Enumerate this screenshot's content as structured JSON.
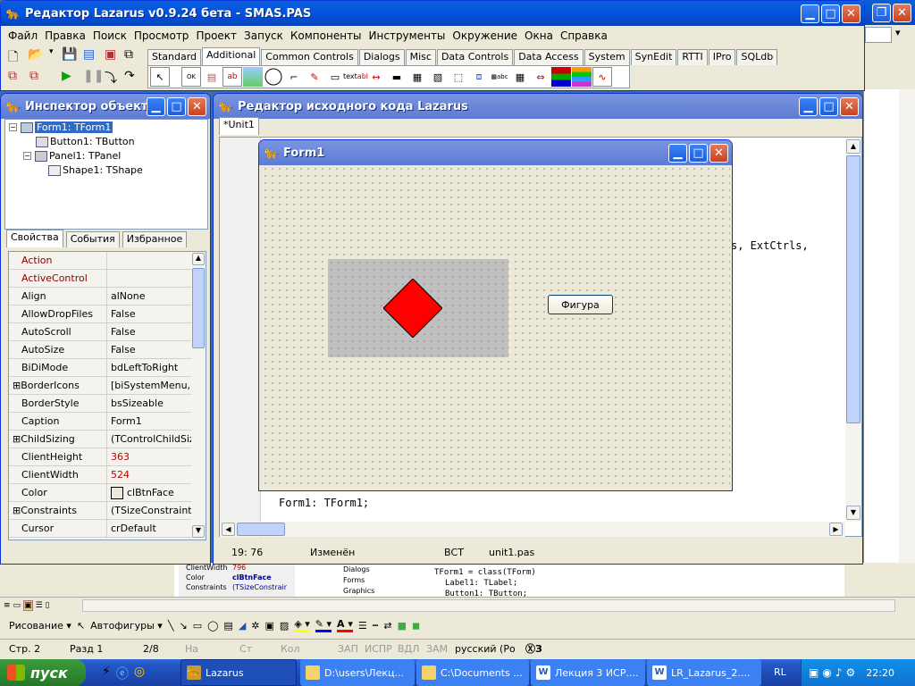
{
  "main_window": {
    "title": "Редактор Lazarus v0.9.24 бета - SMAS.PAS",
    "menu": [
      "Файл",
      "Правка",
      "Поиск",
      "Просмотр",
      "Проект",
      "Запуск",
      "Компоненты",
      "Инструменты",
      "Окружение",
      "Окна",
      "Справка"
    ],
    "palette_tabs": [
      "Standard",
      "Additional",
      "Common Controls",
      "Dialogs",
      "Misc",
      "Data Controls",
      "Data Access",
      "System",
      "SynEdit",
      "RTTI",
      "IPro",
      "SQLdb"
    ],
    "active_tab": "Additional",
    "palette_icons": [
      "pointer-icon",
      "bitbtn-icon",
      "speedbutton-icon",
      "staticedit-icon",
      "image-icon",
      "shape-icon",
      "bevel-icon",
      "paintbox-icon",
      "notebook-icon",
      "label-icon",
      "splitter-icon",
      "trayicon-icon",
      "maskedit-icon",
      "checklistbox-icon",
      "scrollbox-icon",
      "application-properties-icon",
      "stringgrid-icon",
      "drawgrid-icon",
      "pairsplitter-icon",
      "colorbox-icon",
      "colorlistbox-icon",
      "chart-icon"
    ]
  },
  "object_inspector": {
    "title": "Инспектор объектов",
    "tree": [
      "Form1: TForm1",
      "Button1: TButton",
      "Panel1: TPanel",
      "Shape1: TShape"
    ],
    "tabs": [
      "Свойства",
      "События",
      "Избранное"
    ],
    "properties": [
      {
        "name": "Action",
        "value": "",
        "style": "red"
      },
      {
        "name": "ActiveControl",
        "value": "",
        "style": "red"
      },
      {
        "name": "Align",
        "value": "alNone",
        "style": ""
      },
      {
        "name": "AllowDropFiles",
        "value": "False",
        "style": ""
      },
      {
        "name": "AutoScroll",
        "value": "False",
        "style": ""
      },
      {
        "name": "AutoSize",
        "value": "False",
        "style": ""
      },
      {
        "name": "BiDiMode",
        "value": "bdLeftToRight",
        "style": ""
      },
      {
        "name": "BorderIcons",
        "value": "[biSystemMenu,biM",
        "style": "expand"
      },
      {
        "name": "BorderStyle",
        "value": "bsSizeable",
        "style": ""
      },
      {
        "name": "Caption",
        "value": "Form1",
        "style": ""
      },
      {
        "name": "ChildSizing",
        "value": "(TControlChildSizin",
        "style": "expand"
      },
      {
        "name": "ClientHeight",
        "value": "363",
        "style": "vred"
      },
      {
        "name": "ClientWidth",
        "value": "524",
        "style": "vred"
      },
      {
        "name": "Color",
        "value": "clBtnFace",
        "style": "color"
      },
      {
        "name": "Constraints",
        "value": "(TSizeConstraints)",
        "style": "expand"
      },
      {
        "name": "Cursor",
        "value": "crDefault",
        "style": ""
      }
    ]
  },
  "source_editor": {
    "title": "Редактор исходного кода Lazarus",
    "tab": "*Unit1",
    "code_line_1": "s, ExtCtrls,",
    "code_line_2": "Form1: TForm1;",
    "status": {
      "pos": "19: 76",
      "state": "Изменён",
      "mode": "ВСТ",
      "file": "unit1.pas"
    }
  },
  "form_designer": {
    "title": "Form1",
    "button_caption": "Фигура",
    "shape_color": "#ff0000",
    "panel_color": "#c0c0c0"
  },
  "word": {
    "drawing_label": "Рисование",
    "autoshapes_label": "Автофигуры",
    "status": [
      "Стр. 2",
      "Разд 1",
      "2/8",
      "На",
      "Ст",
      "Кол",
      "ЗАП",
      "ИСПР",
      "ВДЛ",
      "ЗАМ",
      "русский (Ро"
    ],
    "bg_props": [
      {
        "name": "ClientWidth",
        "value": "796"
      },
      {
        "name": "Color",
        "value": "clBtnFace"
      },
      {
        "name": "Constraints",
        "value": "(TSizeConstrair"
      }
    ],
    "bg_tree": [
      "Dialogs",
      "Forms",
      "Graphics"
    ],
    "bg_code": [
      "TForm1 = class(TForm)",
      "Label1: TLabel;",
      "Button1: TButton;"
    ]
  },
  "taskbar": {
    "start": "пуск",
    "items": [
      "Lazarus",
      "D:\\users\\Лекц...",
      "C:\\Documents ...",
      "Лекция 3 ИСР....",
      "LR_Lazarus_2...."
    ],
    "lang": "RL",
    "time": "22:20"
  }
}
